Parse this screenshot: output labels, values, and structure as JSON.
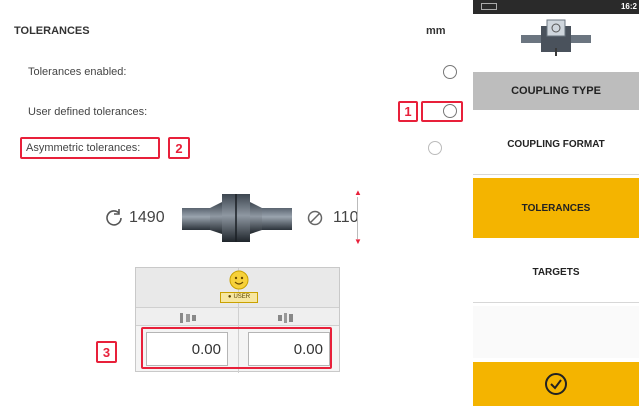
{
  "header": {
    "title": "TOLERANCES",
    "units": "mm"
  },
  "options": {
    "tolerances_enabled": "Tolerances enabled:",
    "user_defined": "User defined tolerances:",
    "asymmetric": "Asymmetric tolerances:"
  },
  "callouts": {
    "one": "1",
    "two": "2",
    "three": "3"
  },
  "coupling": {
    "rpm": "1490",
    "diameter": "110"
  },
  "table": {
    "badge": "USER",
    "values": [
      "0.00",
      "0.00"
    ]
  },
  "sidebar": {
    "status_time": "16:2",
    "coupling_type": "COUPLING TYPE",
    "coupling_format": "COUPLING FORMAT",
    "tolerances": "TOLERANCES",
    "targets": "TARGETS"
  },
  "colors": {
    "accent": "#f4b400",
    "callout_red": "#e8203a",
    "header_gray": "#bdbdbd"
  }
}
